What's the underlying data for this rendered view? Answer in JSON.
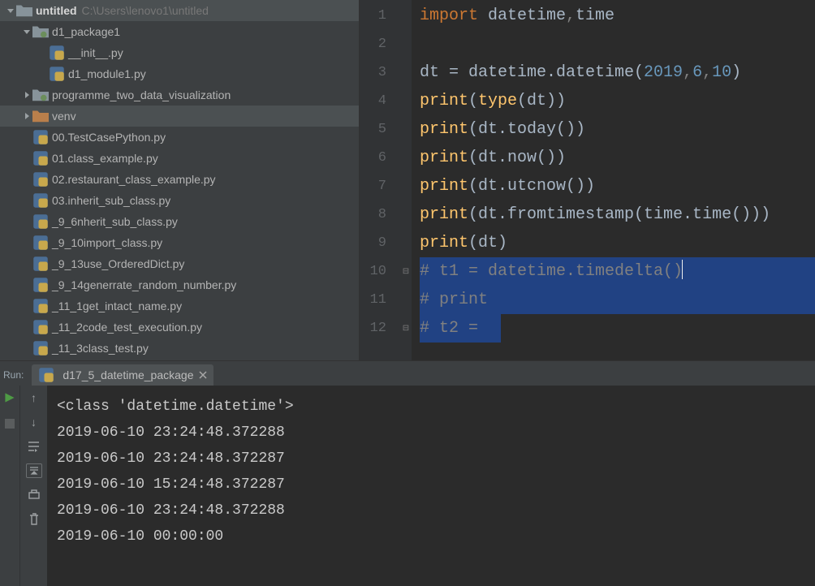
{
  "tree": {
    "project": {
      "name": "untitled",
      "path": "C:\\Users\\lenovo1\\untitled"
    },
    "items": [
      {
        "depth": 0,
        "arrow": "down",
        "icon": "dir",
        "label": "untitled",
        "isProj": true
      },
      {
        "depth": 1,
        "arrow": "down",
        "icon": "pkg",
        "label": "d1_package1"
      },
      {
        "depth": 2,
        "arrow": "",
        "icon": "py",
        "label": "__init__.py"
      },
      {
        "depth": 2,
        "arrow": "",
        "icon": "py",
        "label": "d1_module1.py"
      },
      {
        "depth": 1,
        "arrow": "right",
        "icon": "pkg",
        "label": "programme_two_data_visualization"
      },
      {
        "depth": 1,
        "arrow": "right",
        "icon": "venv",
        "label": "venv",
        "sel": true
      },
      {
        "depth": 1,
        "arrow": "",
        "icon": "py",
        "label": "00.TestCasePython.py"
      },
      {
        "depth": 1,
        "arrow": "",
        "icon": "py",
        "label": "01.class_example.py"
      },
      {
        "depth": 1,
        "arrow": "",
        "icon": "py",
        "label": "02.restaurant_class_example.py"
      },
      {
        "depth": 1,
        "arrow": "",
        "icon": "py",
        "label": "03.inherit_sub_class.py"
      },
      {
        "depth": 1,
        "arrow": "",
        "icon": "py",
        "label": "_9_6nherit_sub_class.py"
      },
      {
        "depth": 1,
        "arrow": "",
        "icon": "py",
        "label": "_9_10import_class.py"
      },
      {
        "depth": 1,
        "arrow": "",
        "icon": "py",
        "label": "_9_13use_OrderedDict.py"
      },
      {
        "depth": 1,
        "arrow": "",
        "icon": "py",
        "label": "_9_14generrate_random_number.py"
      },
      {
        "depth": 1,
        "arrow": "",
        "icon": "py",
        "label": "_11_1get_intact_name.py"
      },
      {
        "depth": 1,
        "arrow": "",
        "icon": "py",
        "label": "_11_2code_test_execution.py"
      },
      {
        "depth": 1,
        "arrow": "",
        "icon": "py",
        "label": "_11_3class_test.py"
      }
    ]
  },
  "code": [
    {
      "n": 1,
      "t": [
        [
          "kw",
          "import "
        ],
        [
          "pl",
          "datetime"
        ],
        [
          "cm",
          ","
        ],
        [
          "pl",
          "time"
        ]
      ]
    },
    {
      "n": 2,
      "t": []
    },
    {
      "n": 3,
      "t": [
        [
          "pl",
          "dt = datetime.datetime("
        ],
        [
          "nm",
          "2019"
        ],
        [
          "cm",
          ","
        ],
        [
          "nm",
          "6"
        ],
        [
          "cm",
          ","
        ],
        [
          "nm",
          "10"
        ],
        [
          "pl",
          ")"
        ]
      ]
    },
    {
      "n": 4,
      "t": [
        [
          "fn",
          "print"
        ],
        [
          "pl",
          "("
        ],
        [
          "fn",
          "type"
        ],
        [
          "pl",
          "(dt))"
        ]
      ]
    },
    {
      "n": 5,
      "t": [
        [
          "fn",
          "print"
        ],
        [
          "pl",
          "(dt.today())"
        ]
      ]
    },
    {
      "n": 6,
      "t": [
        [
          "fn",
          "print"
        ],
        [
          "pl",
          "(dt.now())"
        ]
      ]
    },
    {
      "n": 7,
      "t": [
        [
          "fn",
          "print"
        ],
        [
          "pl",
          "(dt.utcnow())"
        ]
      ]
    },
    {
      "n": 8,
      "t": [
        [
          "fn",
          "print"
        ],
        [
          "pl",
          "(dt.fromtimestamp(time.time()))"
        ]
      ]
    },
    {
      "n": 9,
      "t": [
        [
          "fn",
          "print"
        ],
        [
          "pl",
          "(dt)"
        ]
      ]
    },
    {
      "n": 10,
      "t": [
        [
          "cm",
          "# t1 = datetime.timedelta()"
        ]
      ],
      "sel": true,
      "caret": true
    },
    {
      "n": 11,
      "t": [
        [
          "cm",
          "# print"
        ]
      ],
      "sel": true
    },
    {
      "n": 12,
      "t": [
        [
          "cm",
          "# t2 = "
        ]
      ],
      "sel": true,
      "short": true
    }
  ],
  "run": {
    "panel_label": "Run:",
    "tab": "d17_5_datetime_package",
    "lines": [
      "<class 'datetime.datetime'>",
      "2019-06-10 23:24:48.372288",
      "2019-06-10 23:24:48.372287",
      "2019-06-10 15:24:48.372287",
      "2019-06-10 23:24:48.372288",
      "2019-06-10 00:00:00"
    ]
  }
}
